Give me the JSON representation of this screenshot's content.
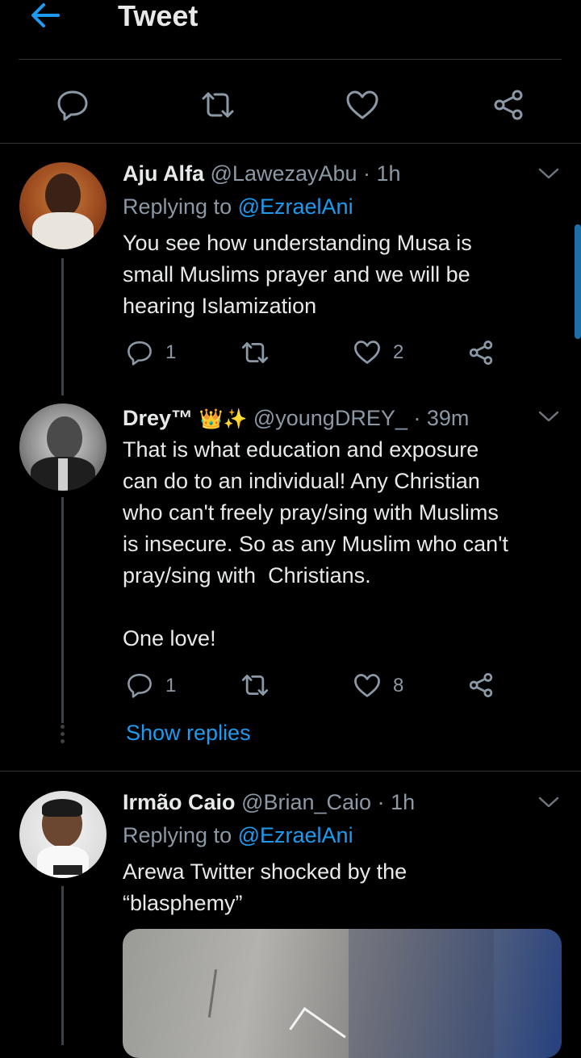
{
  "header": {
    "title": "Tweet"
  },
  "tweets": [
    {
      "name": "Aju Alfa",
      "handle": "@LawezayAbu",
      "time": "· 1h",
      "replying_prefix": "Replying to",
      "replying_to": "@EzraelAni",
      "lines": [
        "You see how understanding Musa is",
        "small Muslims prayer and we will be",
        "hearing Islamization"
      ],
      "replies": "1",
      "likes": "2"
    },
    {
      "name": "Drey™",
      "badges": "👑✨",
      "handle": "@youngDREY_",
      "time": "· 39m",
      "lines": [
        "That is what education and exposure",
        "can do to an individual! Any Christian",
        "who can't freely pray/sing with Muslims",
        "is insecure. So as any Muslim who can't",
        "pray/sing with  Christians.",
        "",
        "One love!"
      ],
      "replies": "1",
      "likes": "8",
      "show_replies": "Show replies"
    },
    {
      "name": "Irmão Caio",
      "handle": "@Brian_Caio",
      "time": "· 1h",
      "replying_prefix": "Replying to",
      "replying_to": "@EzraelAni",
      "lines": [
        "Arewa Twitter shocked by the",
        "“blasphemy”"
      ]
    }
  ],
  "colors": {
    "background": "#000000",
    "accent": "#1d9bf0",
    "muted": "#8b98a5"
  },
  "icons": [
    "back-arrow-icon",
    "reply-icon",
    "retweet-icon",
    "like-icon",
    "share-icon",
    "chevron-down-icon",
    "more-dots-icon"
  ]
}
